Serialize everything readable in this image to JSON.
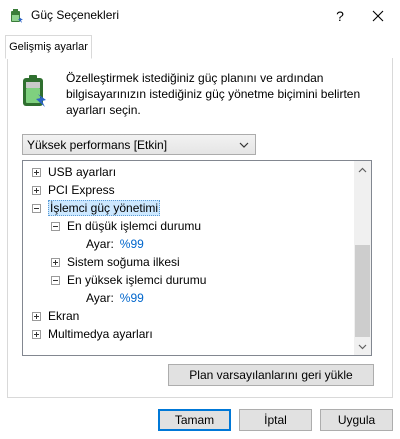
{
  "window": {
    "title": "Güç Seçenekleri",
    "help_label": "?",
    "close_icon": "close-icon",
    "app_icon": "power-options-icon"
  },
  "tabs": [
    {
      "label": "Gelişmiş ayarlar",
      "active": true
    }
  ],
  "description": "Özelleştirmek istediğiniz güç planını ve ardından bilgisayarınızın istediğiniz güç yönetme biçimini belirten ayarları seçin.",
  "plan_select": {
    "value": "Yüksek performans [Etkin]"
  },
  "tree": {
    "items": [
      {
        "label": "USB ayarları",
        "expanded": false
      },
      {
        "label": "PCI Express",
        "expanded": false
      },
      {
        "label": "İşlemci güç yönetimi",
        "expanded": true,
        "selected": true
      },
      {
        "label": "En düşük işlemci durumu",
        "expanded": true
      },
      {
        "label": "Ayar:",
        "value": "%99"
      },
      {
        "label": "Sistem soğuma ilkesi",
        "expanded": false
      },
      {
        "label": "En yüksek işlemci durumu",
        "expanded": true
      },
      {
        "label": "Ayar:",
        "value": "%99"
      },
      {
        "label": "Ekran",
        "expanded": false
      },
      {
        "label": "Multimedya ayarları",
        "expanded": false
      }
    ]
  },
  "buttons": {
    "restore": "Plan varsayılanlarını geri yükle",
    "ok": "Tamam",
    "cancel": "İptal",
    "apply": "Uygula"
  },
  "colors": {
    "selection_bg": "#cce8ff",
    "link_value": "#0066cc",
    "default_button_border": "#0078d7"
  }
}
